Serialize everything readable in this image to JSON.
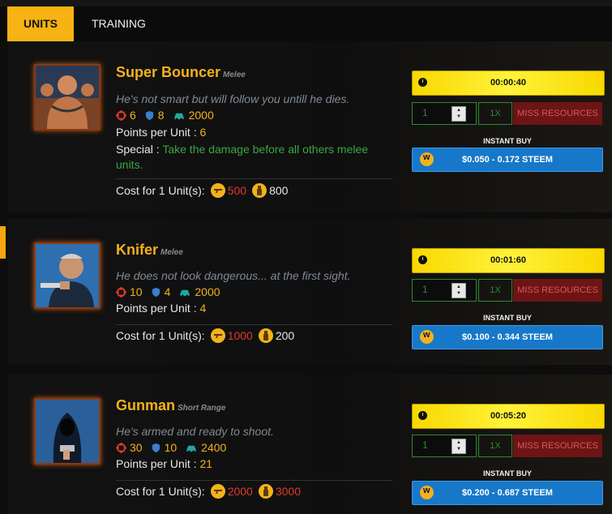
{
  "tabs": {
    "units": "UNITS",
    "training": "TRAINING"
  },
  "units": [
    {
      "name": "Super Bouncer",
      "category": "Melee",
      "description": "He's not smart but will follow you untill he dies.",
      "attack": "6",
      "defense": "8",
      "speed": "2000",
      "ppu_label": "Points per Unit :",
      "ppu": "6",
      "special_label": "Special :",
      "special": "Take the damage before all others melee units.",
      "cost_label": "Cost for 1 Unit(s):",
      "cost_gun": "500",
      "cost_bottle": "800",
      "timer": "00:00:40",
      "qty": "1",
      "multiplier": "1X",
      "miss_label": "MISS RESOURCES",
      "instant_label": "INSTANT BUY",
      "price": "$0.050 - 0.172 STEEM"
    },
    {
      "name": "Knifer",
      "category": "Melee",
      "description": "He does not look dangerous... at the first sight.",
      "attack": "10",
      "defense": "4",
      "speed": "2000",
      "ppu_label": "Points per Unit :",
      "ppu": "4",
      "cost_label": "Cost for 1 Unit(s):",
      "cost_gun": "1000",
      "cost_bottle": "200",
      "timer": "00:01:60",
      "qty": "1",
      "multiplier": "1X",
      "miss_label": "MISS RESOURCES",
      "instant_label": "INSTANT BUY",
      "price": "$0.100 - 0.344 STEEM"
    },
    {
      "name": "Gunman",
      "category": "Short Range",
      "description": "He's armed and ready to shoot.",
      "attack": "30",
      "defense": "10",
      "speed": "2400",
      "ppu_label": "Points per Unit :",
      "ppu": "21",
      "cost_label": "Cost for 1 Unit(s):",
      "cost_gun": "2000",
      "cost_bottle": "3000",
      "timer": "00:05:20",
      "qty": "1",
      "multiplier": "1X",
      "miss_label": "MISS RESOURCES",
      "instant_label": "INSTANT BUY",
      "price": "$0.200 - 0.687 STEEM"
    }
  ],
  "colors": {
    "accent": "#f2b21a",
    "red": "#e03a2a",
    "green": "#3aa640",
    "blue": "#1778c9"
  },
  "icons": [
    "attack-crosshair-icon",
    "defense-shield-icon",
    "speed-car-icon",
    "gun-coin-icon",
    "bottle-coin-icon",
    "clock-icon",
    "steem-icon"
  ]
}
